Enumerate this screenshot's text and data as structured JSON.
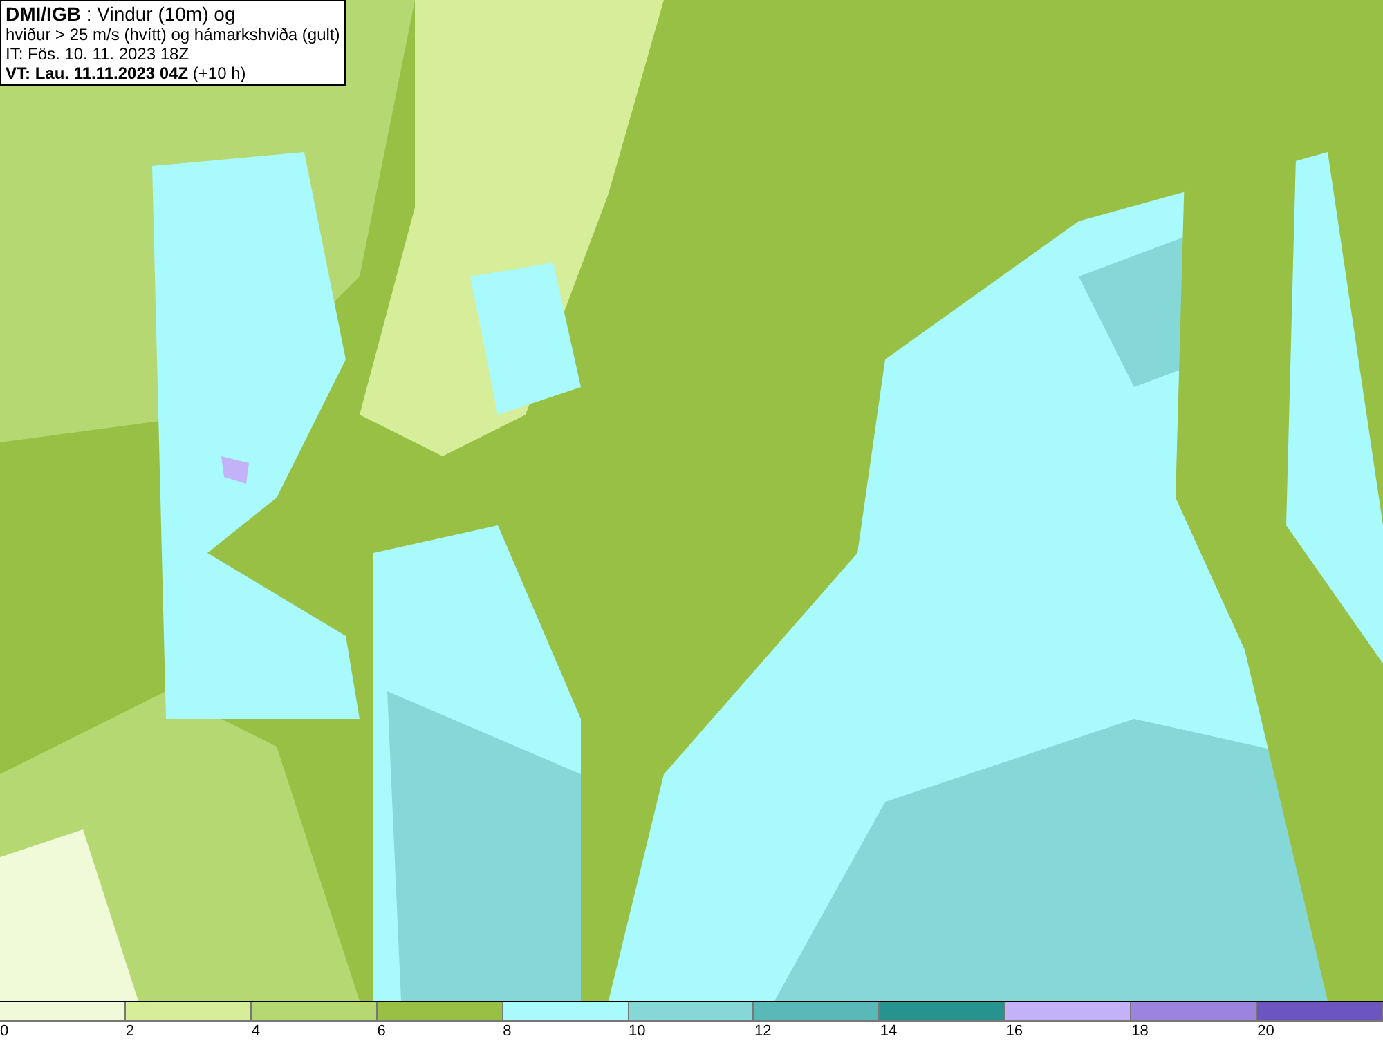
{
  "title_box": {
    "lines": [
      "**DMI/IGB** : Vindur (10m) og",
      "hviður > 25 m/s (hvítt) og hámarkshviða (gult)",
      "IT: Fös. 10. 11. 2023 18Z",
      "**VT: Lau. 11.11.2023 04Z** (+10 h)"
    ]
  },
  "legend": {
    "segments": [
      {
        "label": "0",
        "color": "#f0f9d8"
      },
      {
        "label": "2",
        "color": "#d6ee9a"
      },
      {
        "label": "4",
        "color": "#b5d872"
      },
      {
        "label": "6",
        "color": "#98c045"
      },
      {
        "label": "8",
        "color": "#a9fafc"
      },
      {
        "label": "10",
        "color": "#86d8d8"
      },
      {
        "label": "12",
        "color": "#5bb8b8"
      },
      {
        "label": "14",
        "color": "#27938f"
      },
      {
        "label": "16",
        "color": "#c4b2f8"
      },
      {
        "label": "18",
        "color": "#9b84de"
      },
      {
        "label": "20",
        "color": "#6d55c0"
      }
    ]
  }
}
